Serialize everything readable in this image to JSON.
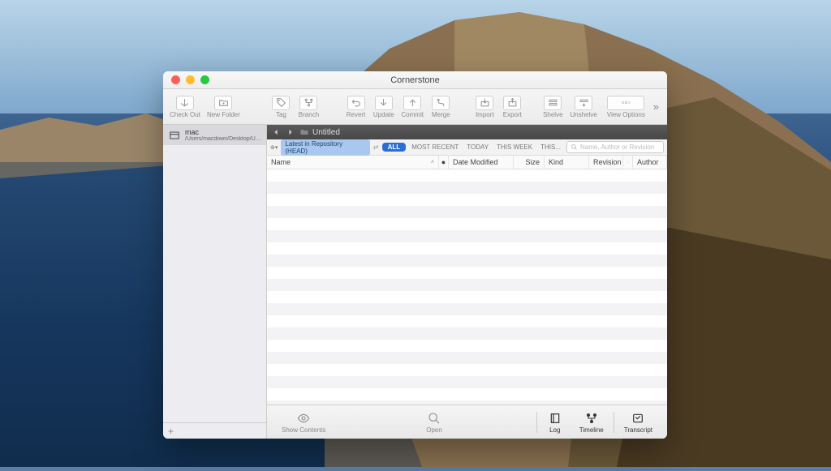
{
  "window": {
    "title": "Cornerstone"
  },
  "toolbar": {
    "checkout": "Check Out",
    "newfolder": "New Folder",
    "tag": "Tag",
    "branch": "Branch",
    "revert": "Revert",
    "update": "Update",
    "commit": "Commit",
    "merge": "Merge",
    "import": "Import",
    "export": "Export",
    "shelve": "Shelve",
    "unshelve": "Unshelve",
    "viewoptions": "View Options"
  },
  "sidebar": {
    "item": {
      "name": "mac",
      "path": "/Users/macdown/Desktop/Untitled"
    },
    "add": "+"
  },
  "pathbar": {
    "title": "Untitled"
  },
  "filter": {
    "revision": "Latest in Repository (HEAD)",
    "all": "ALL",
    "mostrecent": "MOST RECENT",
    "today": "TODAY",
    "thisweek": "THIS WEEK",
    "this": "THIS...",
    "search_placeholder": "Name, Author or Revision"
  },
  "columns": {
    "name": "Name",
    "date": "Date Modified",
    "size": "Size",
    "kind": "Kind",
    "revision": "Revision",
    "author": "Author"
  },
  "bottom": {
    "showcontents": "Show Contents",
    "open": "Open",
    "log": "Log",
    "timeline": "Timeline",
    "transcript": "Transcript"
  }
}
